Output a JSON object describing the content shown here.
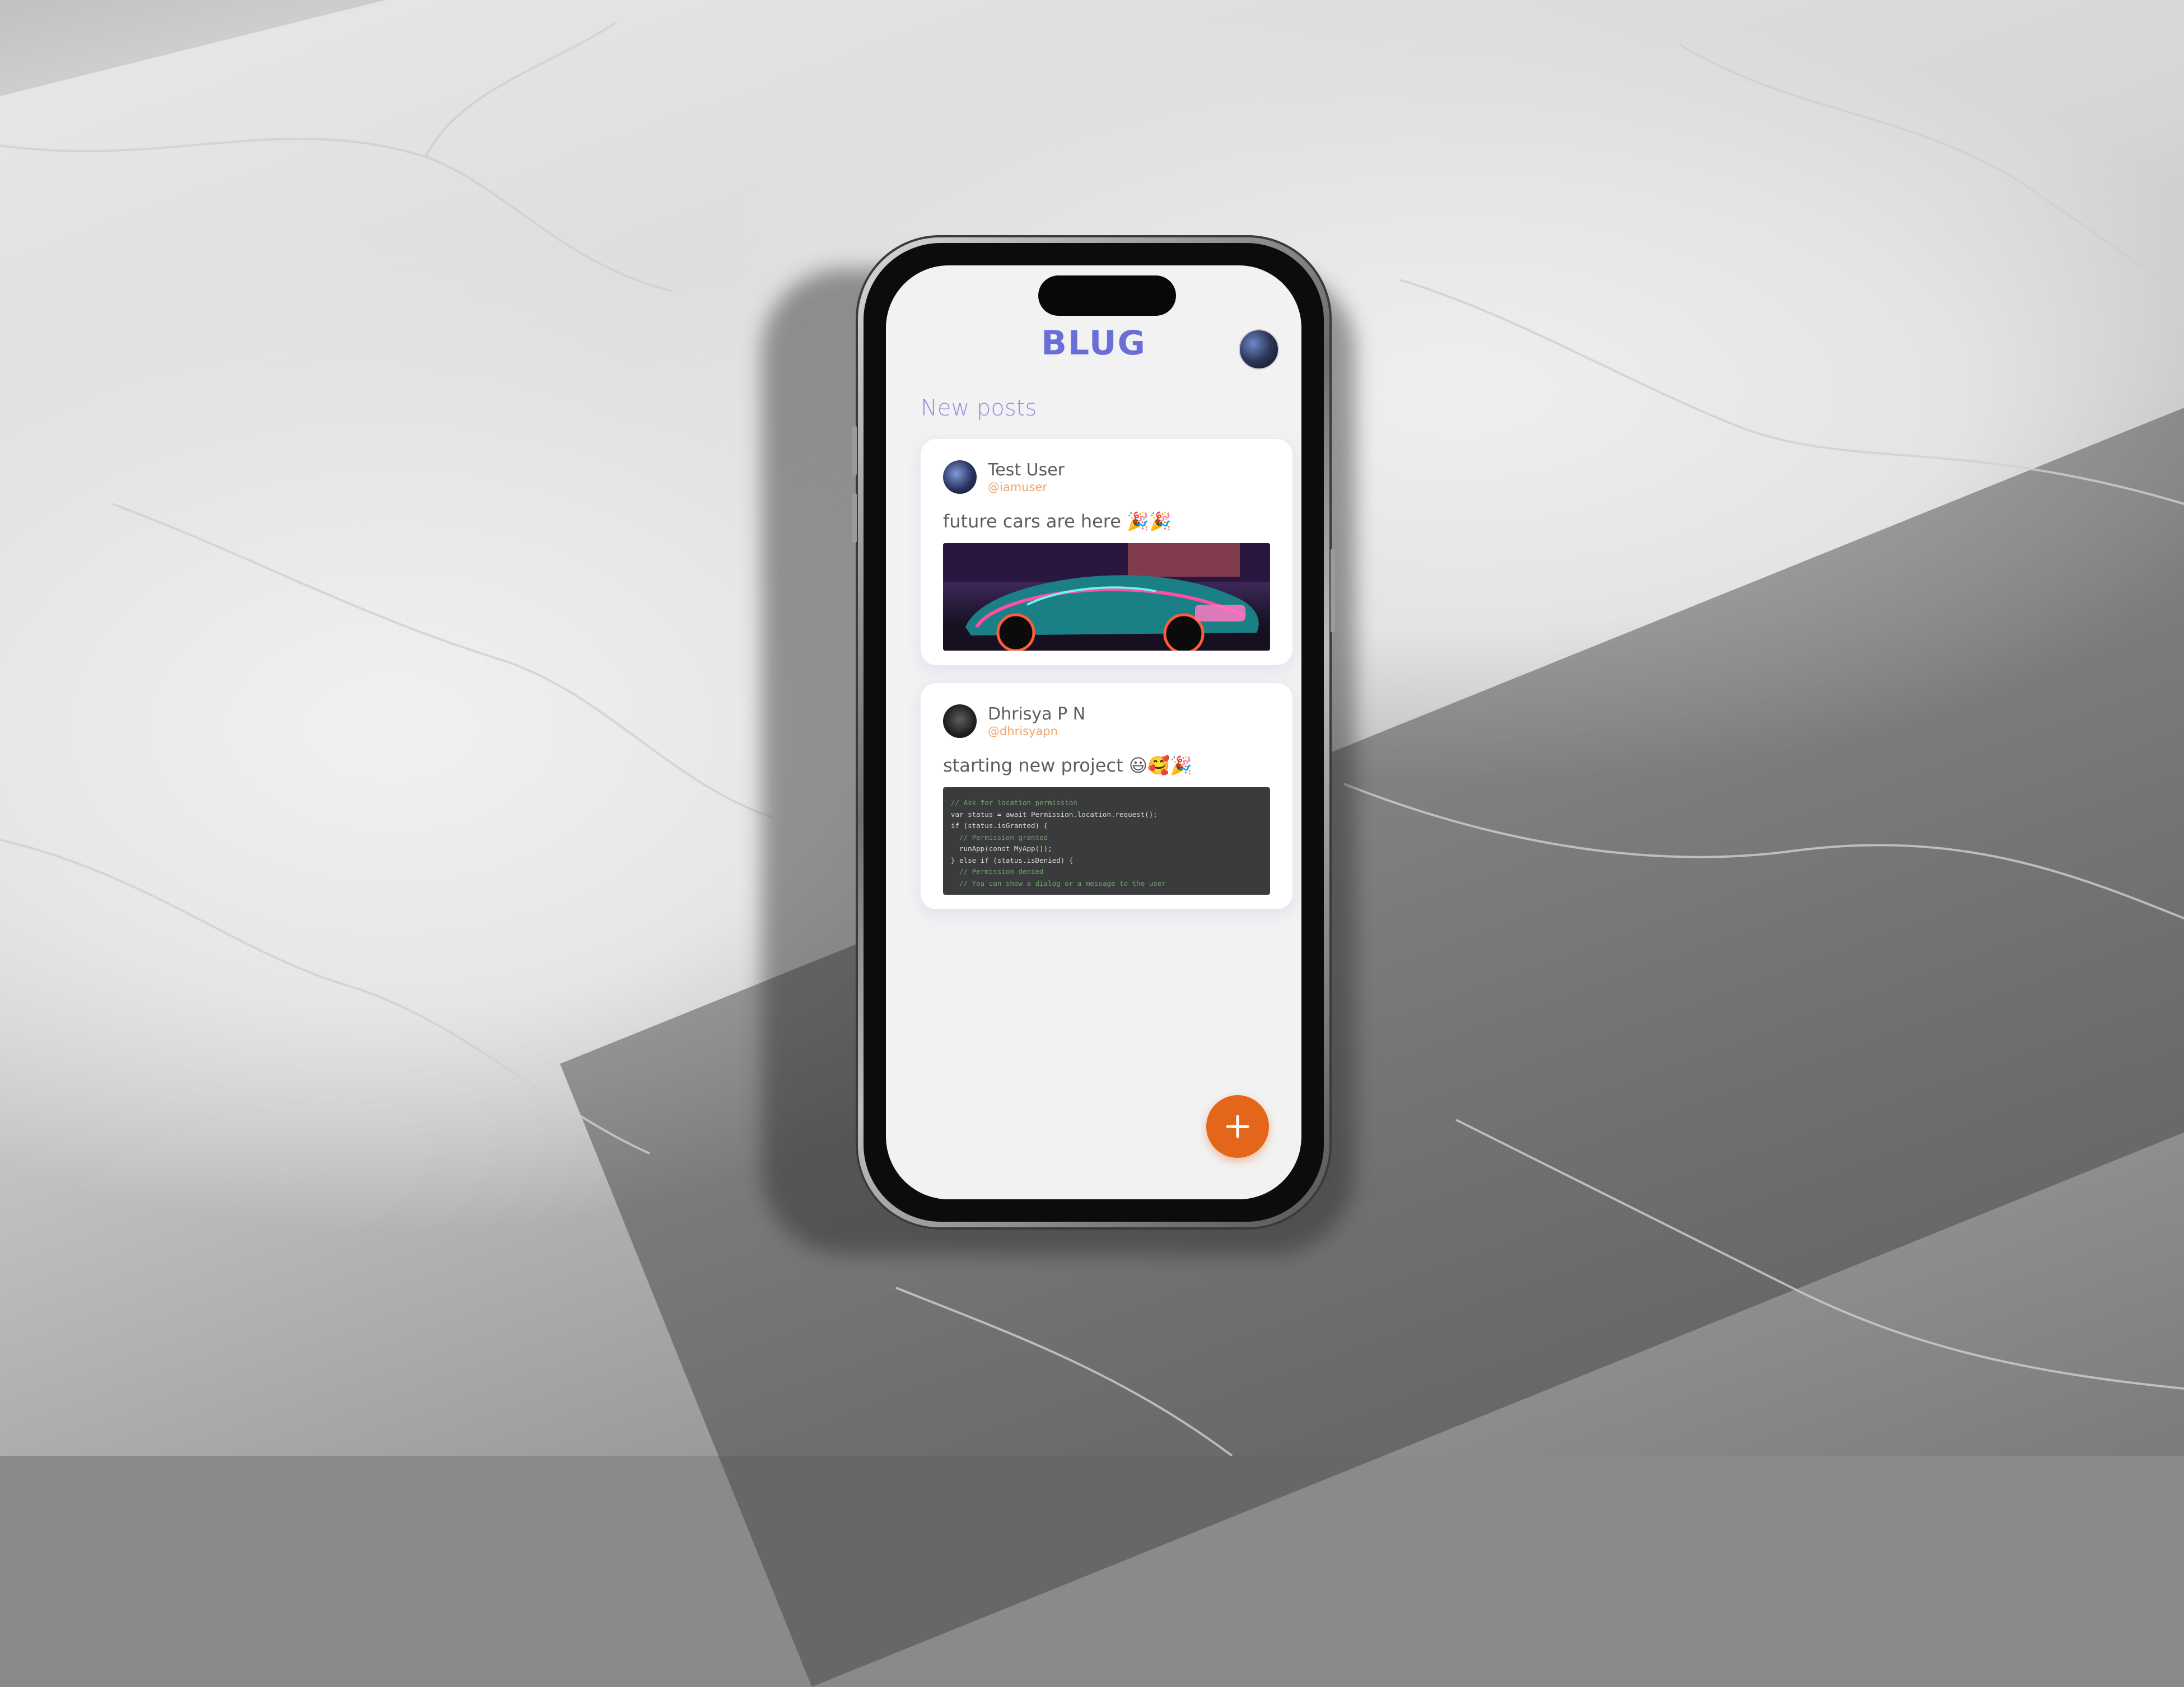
{
  "app": {
    "logo_text": "BLUG",
    "section_title": "New posts"
  },
  "posts": [
    {
      "author_name": "Test User",
      "author_handle": "@iamuser",
      "text": "future cars are here 🎉🎉",
      "media": "neon-sports-car-image"
    },
    {
      "author_name": "Dhrisya P N",
      "author_handle": "@dhrisyapn",
      "text": "starting new project 😃🥰🎉",
      "media": "code-screenshot-image",
      "code_lines": [
        "// Ask for location permission",
        "var status = await Permission.location.request();",
        "if (status.isGranted) {",
        "  // Permission granted",
        "  runApp(const MyApp());",
        "} else if (status.isDenied) {",
        "  // Permission denied",
        "  // You can show a dialog or a message to the user"
      ]
    }
  ],
  "fab": {
    "icon": "plus-icon"
  },
  "colors": {
    "brand": "#6a6fd8",
    "accent": "#e4661a",
    "handle": "#f1a269"
  }
}
